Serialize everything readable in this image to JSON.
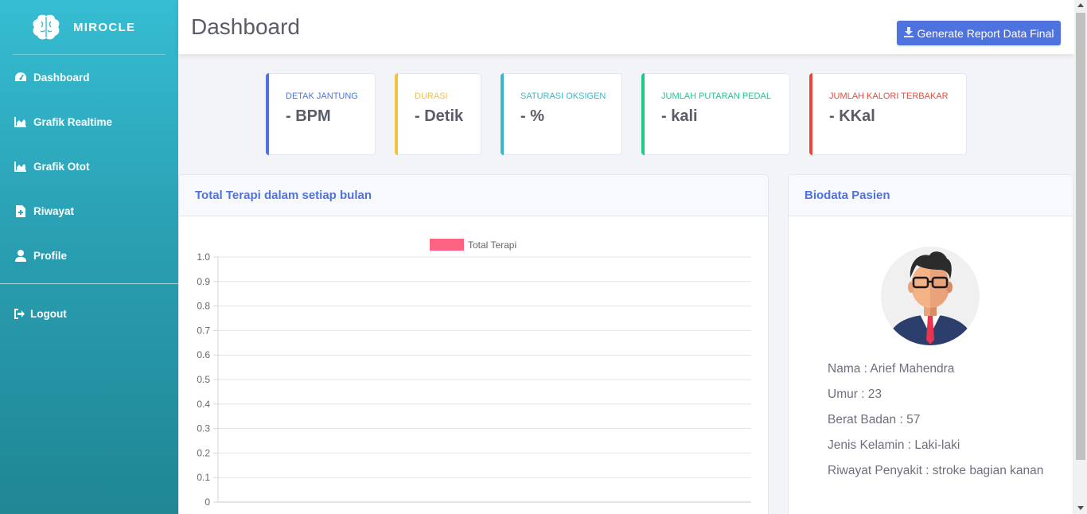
{
  "brand": {
    "name": "MIROCLE",
    "logo_icon": "brain-icon"
  },
  "sidebar": {
    "items": [
      {
        "label": "Dashboard",
        "icon": "tachometer-icon"
      },
      {
        "label": "Grafik Realtime",
        "icon": "area-chart-icon"
      },
      {
        "label": "Grafik Otot",
        "icon": "area-chart-icon"
      },
      {
        "label": "Riwayat",
        "icon": "file-medical-icon"
      },
      {
        "label": "Profile",
        "icon": "user-icon"
      }
    ],
    "logout": {
      "label": "Logout",
      "icon": "sign-out-icon"
    }
  },
  "header": {
    "title": "Dashboard",
    "report_button": "Generate Report Data Final",
    "report_icon": "download-icon"
  },
  "stats": [
    {
      "label": "DETAK JANTUNG",
      "value": "- BPM",
      "color": "#4e73df"
    },
    {
      "label": "DURASI",
      "value": "- Detik",
      "color": "#f6c23e"
    },
    {
      "label": "SATURASI OKSIGEN",
      "value": "- %",
      "color": "#36b9cc"
    },
    {
      "label": "JUMLAH PUTARAN PEDAL",
      "value": "- kali",
      "color": "#1cc88a"
    },
    {
      "label": "JUMLAH KALORI TERBAKAR",
      "value": "- KKal",
      "color": "#e74a3b"
    }
  ],
  "chart_card": {
    "title": "Total Terapi dalam setiap bulan"
  },
  "chart_data": {
    "type": "bar",
    "categories": [],
    "series": [
      {
        "name": "Total Terapi",
        "values": []
      }
    ],
    "ylim": [
      0,
      1.0
    ],
    "yticks": [
      "1.0",
      "0.9",
      "0.8",
      "0.7",
      "0.6",
      "0.5",
      "0.4",
      "0.3",
      "0.2",
      "0.1",
      "0"
    ],
    "legend_position": "top",
    "grid": true,
    "series_color": "#ff6384"
  },
  "biodata": {
    "title": "Biodata Pasien",
    "avatar_icon": "avatar-man-icon",
    "nama": "Nama : Arief Mahendra",
    "umur": "Umur : 23",
    "berat": "Berat Badan : 57",
    "kelamin": "Jenis Kelamin : Laki-laki",
    "riwayat": "Riwayat Penyakit : stroke bagian kanan"
  },
  "colors": {
    "primary": "#4e73df",
    "sidebar": "#36bdd3"
  }
}
